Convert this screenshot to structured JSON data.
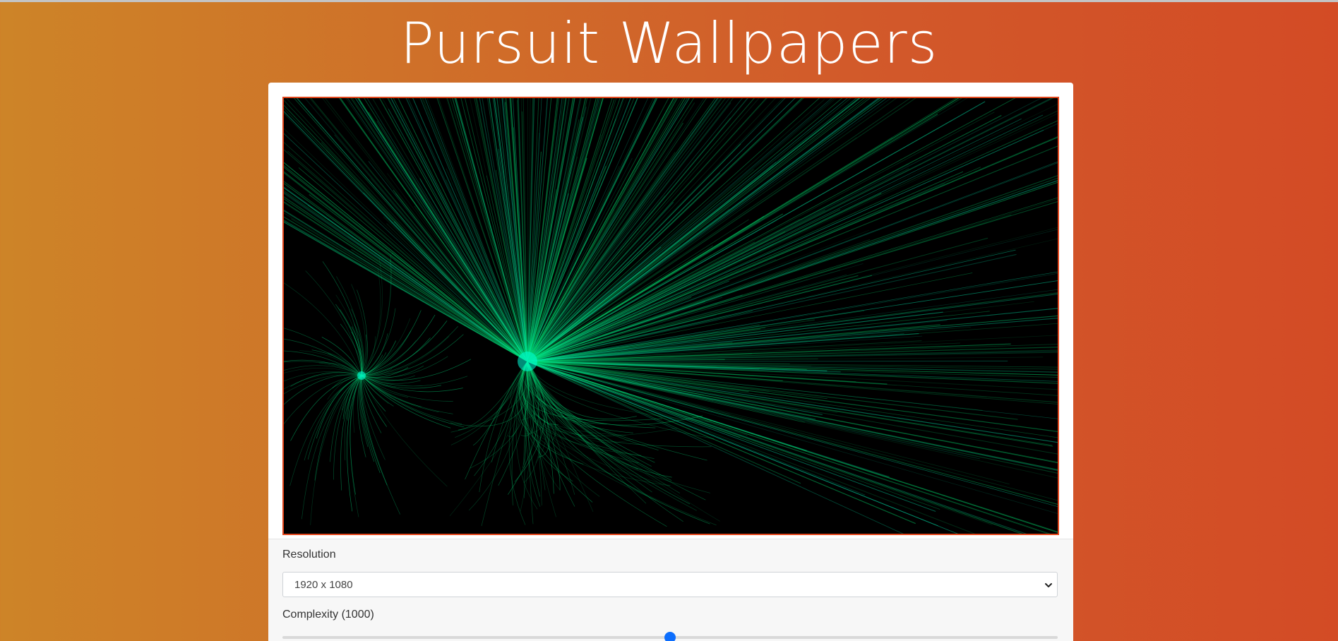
{
  "page": {
    "title": "Pursuit Wallpapers",
    "accent_color": "#e2461b",
    "background_gradient": [
      "#cd8428",
      "#d34b25"
    ]
  },
  "preview": {
    "icon": "wallpaper-preview-image",
    "background_color": "#000000",
    "ray_colors": [
      "#00e27a",
      "#00ffd2"
    ]
  },
  "controls": {
    "resolution": {
      "label": "Resolution",
      "selected": "1920 x 1080"
    },
    "complexity": {
      "label": "Complexity (1000)",
      "value_fraction": 0.5,
      "accent_color": "#0d6efd"
    }
  }
}
